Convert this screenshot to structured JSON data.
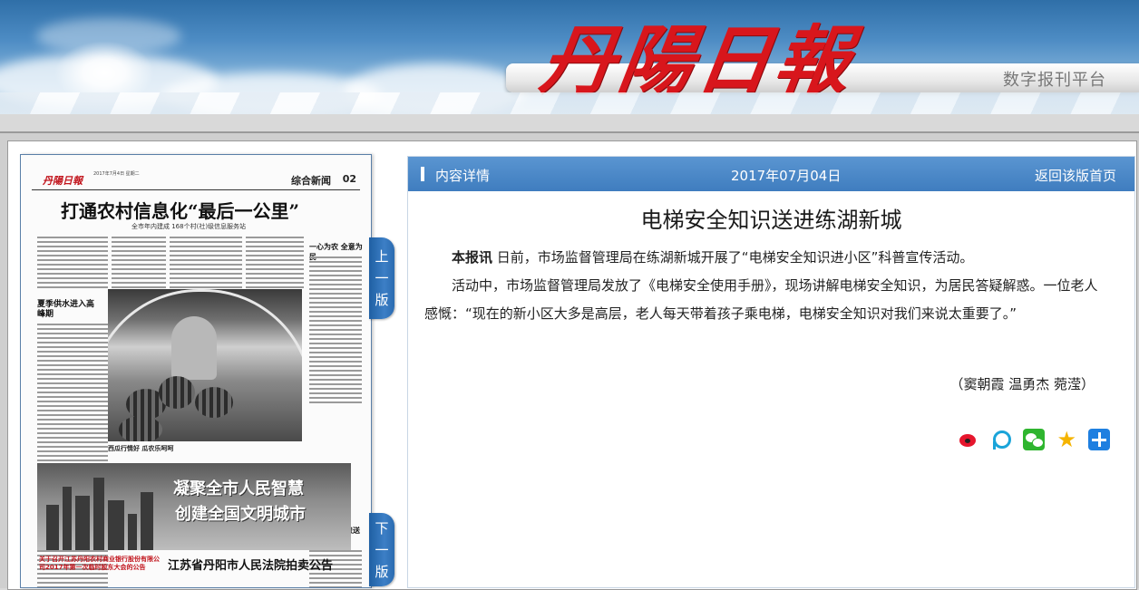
{
  "header": {
    "logo_text": "丹陽日報",
    "platform": "数字报刊平台"
  },
  "newspaper": {
    "masthead": "丹陽日報",
    "meta": "2017年7月4日 星期二",
    "section": "综合新闻",
    "page_no": "02",
    "headline": "打通农村信息化“最后一公里”",
    "subhead": "全市年内建成 168个村(社)级信息服务站",
    "side_title_1": "一心为农 全意为民",
    "side_title_2": "夏季供水进入高峰期",
    "side_title_3": "电梯安全知识送进练湖新城",
    "photo_caption": "西瓜行情好 瓜农乐呵呵",
    "banner_line1": "凝聚全市人民智慧",
    "banner_line2": "创建全国文明城市",
    "notice_left": "关于召开江苏丹阳农村商业银行股份有限公司2017年第一次临时股东大会的公告",
    "notice_right": "江苏省丹阳市人民法院拍卖公告"
  },
  "tabs": {
    "prev": [
      "上",
      "一",
      "版"
    ],
    "next": [
      "下",
      "一",
      "版"
    ]
  },
  "content": {
    "bar_label": "内容详情",
    "date": "2017年07月04日",
    "back_link": "返回该版首页",
    "title": "电梯安全知识送进练湖新城",
    "lead": "本报讯",
    "para1": "日前，市场监督管理局在练湖新城开展了“电梯安全知识进小区”科普宣传活动。",
    "para2": "活动中，市场监督管理局发放了《电梯安全使用手册》，现场讲解电梯安全知识，为居民答疑解惑。一位老人感慨：“现在的新小区大多是高层，老人每天带着孩子乘电梯，电梯安全知识对我们来说太重要了。”",
    "author": "（窦朝霞 温勇杰 菀滢）"
  },
  "share_icons": [
    "weibo-icon",
    "pinterest-icon",
    "wechat-icon",
    "qzone-icon",
    "more-share-icon"
  ],
  "colors": {
    "accent_blue": "#3f7dbf",
    "logo_red": "#d8161c"
  }
}
